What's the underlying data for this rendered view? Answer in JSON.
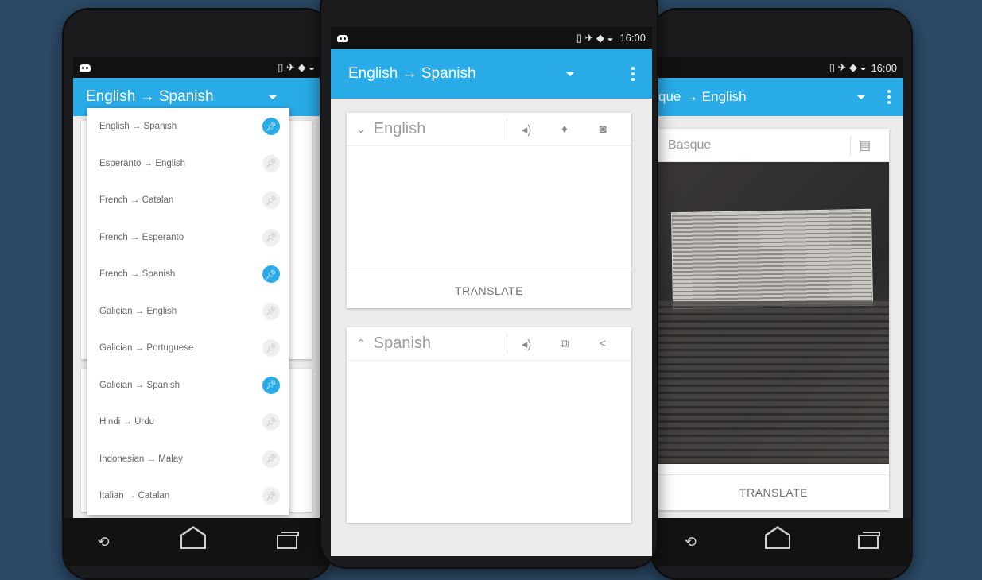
{
  "status_time": "16:00",
  "left_phone": {
    "appbar_title": "English → Spanish",
    "dropdown_items": [
      {
        "label": "English → Spanish",
        "pinned": true
      },
      {
        "label": "Esperanto → English",
        "pinned": false
      },
      {
        "label": "French → Catalan",
        "pinned": false
      },
      {
        "label": "French → Esperanto",
        "pinned": false
      },
      {
        "label": "French → Spanish",
        "pinned": true
      },
      {
        "label": "Galician → English",
        "pinned": false
      },
      {
        "label": "Galician → Portuguese",
        "pinned": false
      },
      {
        "label": "Galician → Spanish",
        "pinned": true
      },
      {
        "label": "Hindi → Urdu",
        "pinned": false
      },
      {
        "label": "Indonesian → Malay",
        "pinned": false
      },
      {
        "label": "Italian → Catalan",
        "pinned": false
      }
    ]
  },
  "center_phone": {
    "appbar_title": "English → Spanish",
    "source_card": {
      "language": "English",
      "translate_label": "TRANSLATE"
    },
    "target_card": {
      "language": "Spanish"
    }
  },
  "right_phone": {
    "appbar_title": "que → English",
    "source_language": "Basque",
    "translate_label": "TRANSLATE"
  },
  "colors": {
    "accent": "#29abe8",
    "background": "#2c4a66"
  }
}
